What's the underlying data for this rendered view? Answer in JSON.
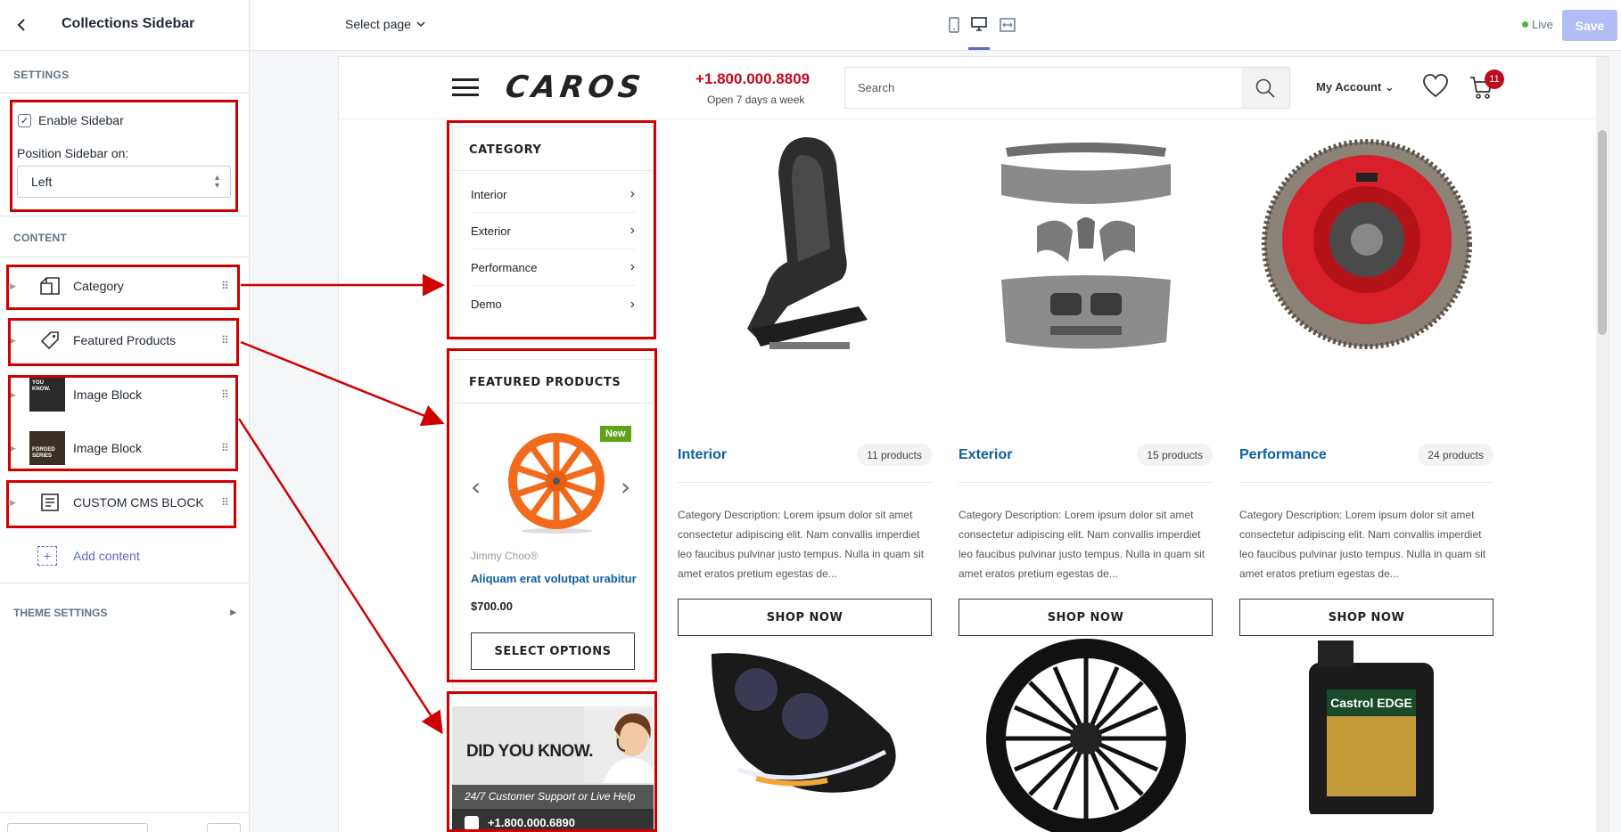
{
  "editor": {
    "title": "Collections Sidebar",
    "settings_heading": "SETTINGS",
    "enable_sidebar_label": "Enable Sidebar",
    "enable_sidebar_checked": true,
    "position_label": "Position Sidebar on:",
    "position_value": "Left",
    "content_heading": "CONTENT",
    "content_items": [
      {
        "label": "Category",
        "icon": "category-icon"
      },
      {
        "label": "Featured Products",
        "icon": "tag-icon"
      },
      {
        "label": "Image Block",
        "icon": "image-thumbnail"
      },
      {
        "label": "Image Block",
        "icon": "image-thumbnail"
      },
      {
        "label": "CUSTOM CMS BLOCK",
        "icon": "document-icon"
      }
    ],
    "thumb1_text": "YOU KNOW.",
    "thumb2_text": "FORGED SERIES",
    "add_content_label": "Add content",
    "theme_settings_heading": "THEME SETTINGS"
  },
  "topbar": {
    "select_page": "Select page",
    "devices": [
      "mobile-icon",
      "desktop-icon",
      "fullscreen-icon"
    ],
    "active_device": "desktop-icon",
    "status": "Live",
    "save_label": "Save"
  },
  "site": {
    "logo": "CAROS",
    "phone": "+1.800.000.8809",
    "hours": "Open 7 days a week",
    "search_placeholder": "Search",
    "account": "My Account",
    "cart_count": "11",
    "category_widget": {
      "title": "CATEGORY",
      "items": [
        "Interior",
        "Exterior",
        "Performance",
        "Demo"
      ]
    },
    "featured_widget": {
      "title": "FEATURED PRODUCTS",
      "badge": "New",
      "brand": "Jimmy Choo®",
      "name": "Aliquam erat volutpat urabitur",
      "price": "$700.00",
      "button": "SELECT OPTIONS"
    },
    "did_you_know": {
      "title": "DID YOU KNOW.",
      "subtitle": "24/7 Customer Support or Live Help",
      "phone": "+1.800.000.6890"
    },
    "collections": [
      {
        "name": "Interior",
        "count": "11 products",
        "desc": "Category Description: Lorem ipsum dolor sit amet consectetur adipiscing elit. Nam convallis imperdiet leo faucibus pulvinar justo tempus. Nulla in quam sit amet eratos pretium egestas de...",
        "button": "SHOP NOW"
      },
      {
        "name": "Exterior",
        "count": "15 products",
        "desc": "Category Description: Lorem ipsum dolor sit amet consectetur adipiscing elit. Nam convallis imperdiet leo faucibus pulvinar justo tempus. Nulla in quam sit amet eratos pretium egestas de...",
        "button": "SHOP NOW"
      },
      {
        "name": "Performance",
        "count": "24 products",
        "desc": "Category Description: Lorem ipsum dolor sit amet consectetur adipiscing elit. Nam convallis imperdiet leo faucibus pulvinar justo tempus. Nulla in quam sit amet eratos pretium egestas de...",
        "button": "SHOP NOW"
      }
    ],
    "castrol_label": "Castrol EDGE"
  },
  "colors": {
    "annotation_red": "#d00000",
    "accent": "#5c6ac4",
    "brand_red": "#c00b1e",
    "link_blue": "#0f5ea0",
    "new_badge": "#5fa31a"
  }
}
